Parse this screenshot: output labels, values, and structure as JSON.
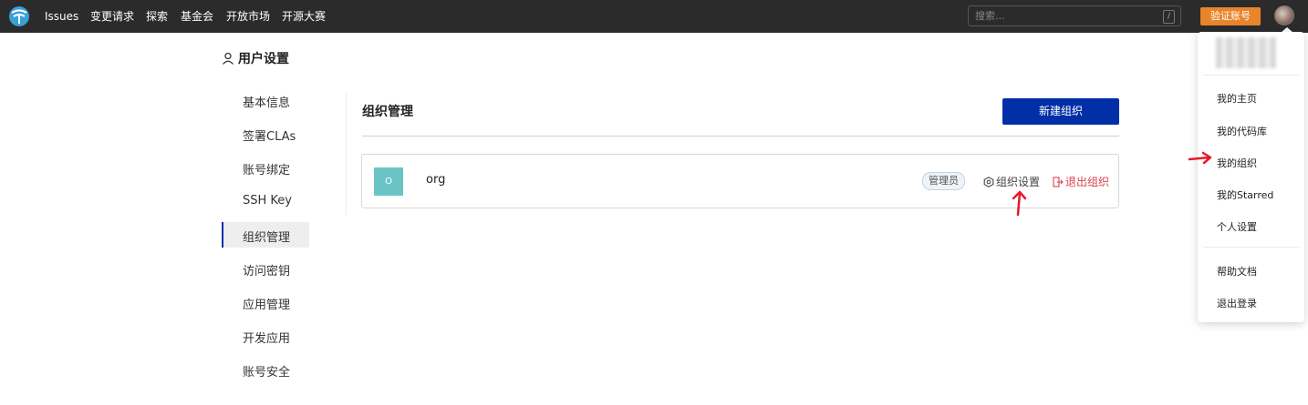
{
  "topbar": {
    "nav": [
      "Issues",
      "变更请求",
      "探索",
      "基金会",
      "开放市场",
      "开源大赛"
    ],
    "search_placeholder": "搜索...",
    "search_shortcut": "/",
    "verify_label": "验证账号"
  },
  "settings": {
    "title": "用户设置",
    "menu": [
      "基本信息",
      "签署CLAs",
      "账号绑定",
      "SSH Key",
      "组织管理",
      "访问密钥",
      "应用管理",
      "开发应用",
      "账号安全"
    ],
    "active_item": "组织管理"
  },
  "main": {
    "section_title": "组织管理",
    "new_org_label": "新建组织",
    "org": {
      "avatar_letter": "O",
      "name": "org",
      "role": "管理员",
      "settings_label": "组织设置",
      "leave_label": "退出组织"
    }
  },
  "user_menu": {
    "items": [
      "我的主页",
      "我的代码库",
      "我的组织",
      "我的Starred",
      "个人设置"
    ],
    "footer_items": [
      "帮助文档",
      "退出登录"
    ]
  },
  "colors": {
    "topbar": "#2b2b2b",
    "primary": "#002fa7",
    "verify": "#e8842c",
    "danger": "#d9434b",
    "annotation_arrow": "#e8192c"
  }
}
